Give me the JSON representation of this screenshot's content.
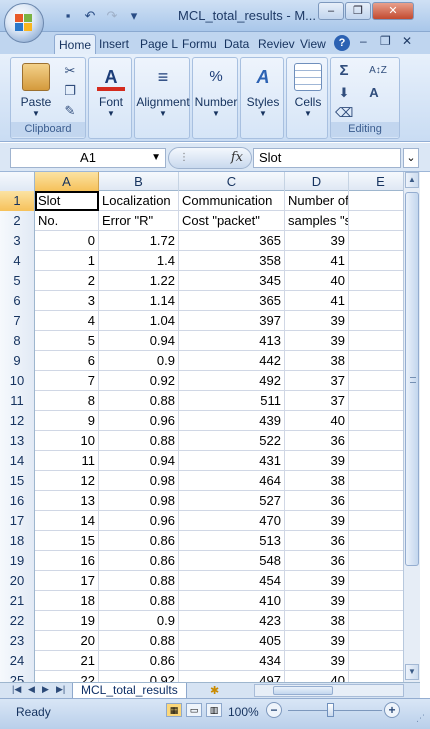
{
  "window": {
    "title": "MCL_total_results - M...",
    "minimize_glyph": "–",
    "restore_glyph": "❐",
    "close_glyph": "✕"
  },
  "quick_access": {
    "icons": [
      "save-icon",
      "undo-icon",
      "redo-icon",
      "customize-icon"
    ],
    "glyphs": [
      "▪",
      "↶",
      "↷",
      "▾"
    ]
  },
  "ribbon": {
    "tabs": [
      "Home",
      "Insert",
      "Page L",
      "Formu",
      "Data",
      "Reviev",
      "View"
    ],
    "active_tab": "Home",
    "help_glyph": "?",
    "ribbon_min_glyph": "–",
    "ribbon_restore_glyph": "❐",
    "ribbon_close_glyph": "✕",
    "groups": {
      "clipboard": {
        "label": "Clipboard",
        "paste_label": "Paste"
      },
      "font": {
        "label": "Font"
      },
      "alignment": {
        "label": "Alignment"
      },
      "number": {
        "label": "Number",
        "glyph": "%"
      },
      "styles": {
        "label": "Styles"
      },
      "cells": {
        "label": "Cells"
      },
      "editing": {
        "label": "Editing",
        "sum_glyph": "Σ",
        "sort_glyph": "A↕Z",
        "find_glyph": "A"
      }
    }
  },
  "formula_bar": {
    "name_box": "A1",
    "fx_label": "fx",
    "formula": "Slot"
  },
  "sheet": {
    "columns": [
      "A",
      "B",
      "C",
      "D",
      "E"
    ],
    "active_cell": "A1",
    "header_rows": [
      {
        "row": "1",
        "cells": [
          "Slot",
          "Localization",
          "Communication",
          "Number of",
          ""
        ]
      },
      {
        "row": "2",
        "cells": [
          "No.",
          "Error \"R\"",
          "Cost \"packet\"",
          "samples \"sample\"",
          ""
        ]
      }
    ],
    "data_rows": [
      {
        "row": "3",
        "slot": "0",
        "error": "1.72",
        "cost": "365",
        "samples": "39"
      },
      {
        "row": "4",
        "slot": "1",
        "error": "1.4",
        "cost": "358",
        "samples": "41"
      },
      {
        "row": "5",
        "slot": "2",
        "error": "1.22",
        "cost": "345",
        "samples": "40"
      },
      {
        "row": "6",
        "slot": "3",
        "error": "1.14",
        "cost": "365",
        "samples": "41"
      },
      {
        "row": "7",
        "slot": "4",
        "error": "1.04",
        "cost": "397",
        "samples": "39"
      },
      {
        "row": "8",
        "slot": "5",
        "error": "0.94",
        "cost": "413",
        "samples": "39"
      },
      {
        "row": "9",
        "slot": "6",
        "error": "0.9",
        "cost": "442",
        "samples": "38"
      },
      {
        "row": "10",
        "slot": "7",
        "error": "0.92",
        "cost": "492",
        "samples": "37"
      },
      {
        "row": "11",
        "slot": "8",
        "error": "0.88",
        "cost": "511",
        "samples": "37"
      },
      {
        "row": "12",
        "slot": "9",
        "error": "0.96",
        "cost": "439",
        "samples": "40"
      },
      {
        "row": "13",
        "slot": "10",
        "error": "0.88",
        "cost": "522",
        "samples": "36"
      },
      {
        "row": "14",
        "slot": "11",
        "error": "0.94",
        "cost": "431",
        "samples": "39"
      },
      {
        "row": "15",
        "slot": "12",
        "error": "0.98",
        "cost": "464",
        "samples": "38"
      },
      {
        "row": "16",
        "slot": "13",
        "error": "0.98",
        "cost": "527",
        "samples": "36"
      },
      {
        "row": "17",
        "slot": "14",
        "error": "0.96",
        "cost": "470",
        "samples": "39"
      },
      {
        "row": "18",
        "slot": "15",
        "error": "0.86",
        "cost": "513",
        "samples": "36"
      },
      {
        "row": "19",
        "slot": "16",
        "error": "0.86",
        "cost": "548",
        "samples": "36"
      },
      {
        "row": "20",
        "slot": "17",
        "error": "0.88",
        "cost": "454",
        "samples": "39"
      },
      {
        "row": "21",
        "slot": "18",
        "error": "0.88",
        "cost": "410",
        "samples": "39"
      },
      {
        "row": "22",
        "slot": "19",
        "error": "0.9",
        "cost": "423",
        "samples": "38"
      },
      {
        "row": "23",
        "slot": "20",
        "error": "0.88",
        "cost": "405",
        "samples": "39"
      },
      {
        "row": "24",
        "slot": "21",
        "error": "0.86",
        "cost": "434",
        "samples": "39"
      },
      {
        "row": "25",
        "slot": "22",
        "error": "0.92",
        "cost": "497",
        "samples": "40"
      }
    ]
  },
  "sheet_tabs": {
    "nav_glyphs": [
      "|◀",
      "◀",
      "▶",
      "▶|"
    ],
    "active_sheet": "MCL_total_results",
    "new_sheet_glyph": "✱"
  },
  "status_bar": {
    "status": "Ready",
    "zoom": "100%",
    "zoom_out_glyph": "−",
    "zoom_in_glyph": "+",
    "zoom_fraction": 0.5
  },
  "colors": {
    "accent": "#2c62b3",
    "selection_header": "#f6c15a",
    "grid_line": "#d0d7e5"
  }
}
